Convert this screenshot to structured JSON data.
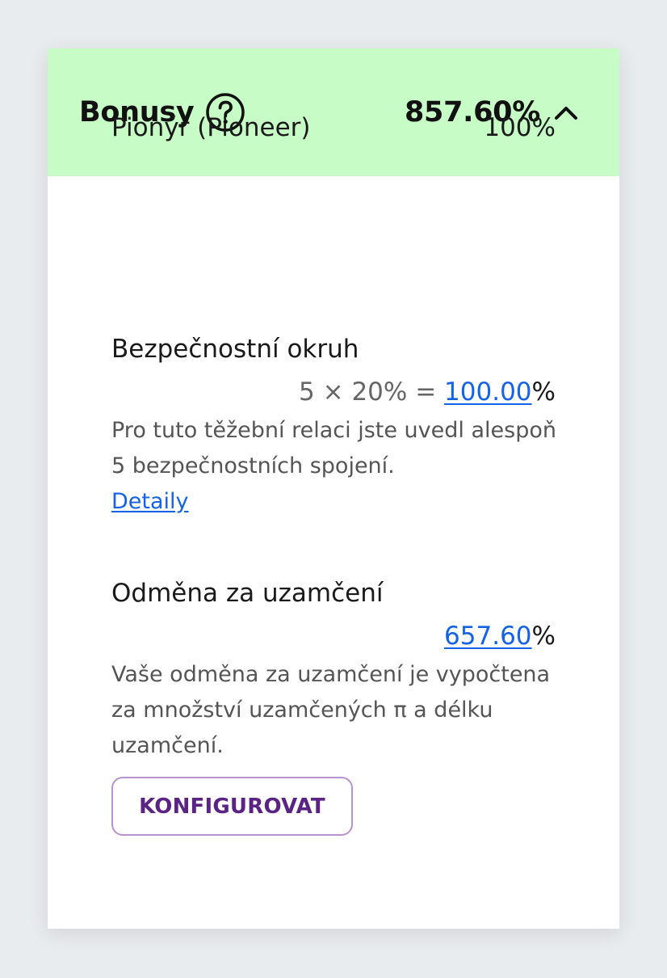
{
  "header": {
    "title": "Bonusy",
    "help_icon": "question-circle-icon",
    "total": "857.60%",
    "toggle_icon": "chevron-up-icon",
    "background_color": "#c8fcc6"
  },
  "pioneer": {
    "label": "Pionýr (Pioneer)",
    "value": "100%"
  },
  "security_circle": {
    "title": "Bezpečnostní okruh",
    "formula": "5 × 20% = ",
    "value": "100.00",
    "percent": "%",
    "description": "Pro tuto těžební relaci jste uvedl alespoň 5 bezpečnostních spojení.",
    "details_link": "Detaily"
  },
  "lockup_reward": {
    "title": "Odměna za uzamčení",
    "value": "657.60",
    "percent": "%",
    "description": "Vaše odměna za uzamčení je vypočtena za množství uzamčených π a délku uzamčení.",
    "button_label": "KONFIGUROVAT"
  },
  "colors": {
    "link": "#1463e6",
    "button_text": "#5a2384",
    "button_border": "#b794cf"
  }
}
